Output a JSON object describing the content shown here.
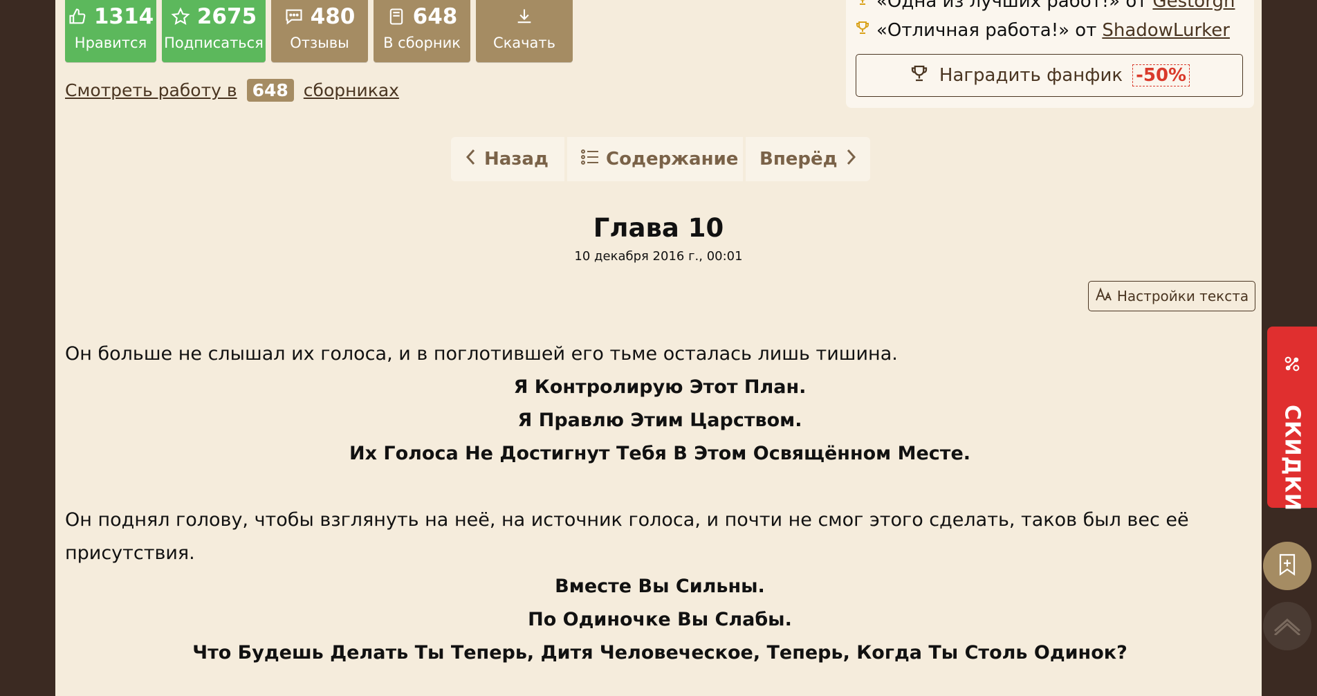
{
  "stats": [
    {
      "value": "1314",
      "label": "Нравится",
      "icon": "thumbs-up-icon",
      "color": "#5cb85c"
    },
    {
      "value": "2675",
      "label": "Подписаться",
      "icon": "star-icon",
      "color": "#5cb85c"
    },
    {
      "value": "480",
      "label": "Отзывы",
      "icon": "comment-icon",
      "color": "#a58c63"
    },
    {
      "value": "648",
      "label": "В сборник",
      "icon": "collection-icon",
      "color": "#a58c63"
    },
    {
      "value": "",
      "label": "Скачать",
      "icon": "download-icon",
      "color": "#a58c63"
    }
  ],
  "collections": {
    "prefix": "Смотреть работу в",
    "count": "648",
    "suffix": "сборниках"
  },
  "rewards": {
    "items": [
      {
        "text": "«Одна из лучших работ!» от",
        "user": "Gestorgh"
      },
      {
        "text": "«Отличная работа!» от",
        "user": "ShadowLurker"
      }
    ],
    "award_label": "Наградить фанфик",
    "award_discount": "-50%"
  },
  "nav": {
    "back": "Назад",
    "contents": "Содержание",
    "forward": "Вперёд"
  },
  "chapter": {
    "title": "Глава 10",
    "date": "10 декабря 2016 г., 00:01",
    "settings_label": "Настройки текста"
  },
  "text": {
    "p1": "Он больше не слышал их голоса, и в поглотившей его тьме осталась лишь тишина.",
    "c1": "Я Контролирую Этот План.",
    "c2": "Я Правлю Этим Царством.",
    "c3": "Их Голоса Не Достигнут Тебя В Этом Освящённом Месте.",
    "p2": "Он поднял голову, чтобы взглянуть на неё, на источник голоса, и почти не смог этого сделать, таков был вес её присутствия.",
    "c4": "Вместе Вы Сильны.",
    "c5": "По Одиночке Вы Слабы.",
    "c6": "Что Будешь Делать Ты Теперь, Дитя Человеческое, Теперь, Когда Ты Столь Одинок?"
  },
  "sale": {
    "label": "СКИДКИ",
    "color": "#e02f2f"
  }
}
